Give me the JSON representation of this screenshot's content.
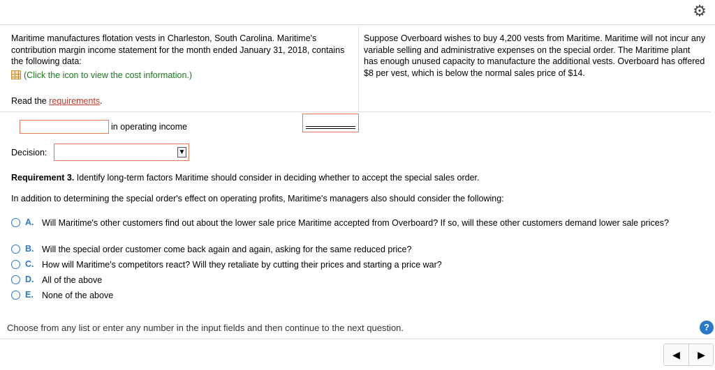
{
  "toolbar": {
    "gear_icon": "gear-icon"
  },
  "problem": {
    "left_text": "Maritime manufactures flotation vests in Charleston, South Carolina. Maritime's contribution margin income statement for the month ended January 31, 2018, contains the following data:",
    "cost_link": "(Click the icon to view the cost information.)",
    "right_text": "Suppose Overboard wishes to buy 4,200 vests from Maritime. Maritime will not incur any variable selling and administrative expenses on the special order. The Maritime plant has enough unused capacity to manufacture the additional vests. Overboard has offered $8 per vest, which is below the normal sales price of $14.",
    "read_prefix": "Read the ",
    "requirements_link": "requirements",
    "read_suffix": "."
  },
  "answer": {
    "operating_income_value": "",
    "operating_income_label": "in operating income",
    "total_value": "",
    "decision_label": "Decision:",
    "decision_selected": ""
  },
  "requirement3": {
    "heading": "Requirement 3.",
    "text": " Identify long-term factors Maritime should consider in deciding whether to accept the special sales order.",
    "intro": "In addition to determining the special order's effect on operating profits, Maritime's managers also should consider the following:",
    "options": [
      {
        "key": "A.",
        "text": "Will Maritime's other customers find out about the lower sale price Maritime accepted from Overboard? If so, will these other customers demand lower sale prices?"
      },
      {
        "key": "B.",
        "text": "Will the special order customer come back again and again, asking for the same reduced price?"
      },
      {
        "key": "C.",
        "text": "How will Maritime's competitors react? Will they retaliate by cutting their prices and starting a price war?"
      },
      {
        "key": "D.",
        "text": "All of the above"
      },
      {
        "key": "E.",
        "text": "None of the above"
      }
    ]
  },
  "footer": {
    "instruction": "Choose from any list or enter any number in the input fields and then continue to the next question.",
    "help_label": "?",
    "prev_label": "◀",
    "next_label": "▶"
  },
  "colors": {
    "accent": "#2a78c8",
    "input_border": "#e07b55",
    "link_red": "#c0392b",
    "green": "#1a7a1a"
  }
}
